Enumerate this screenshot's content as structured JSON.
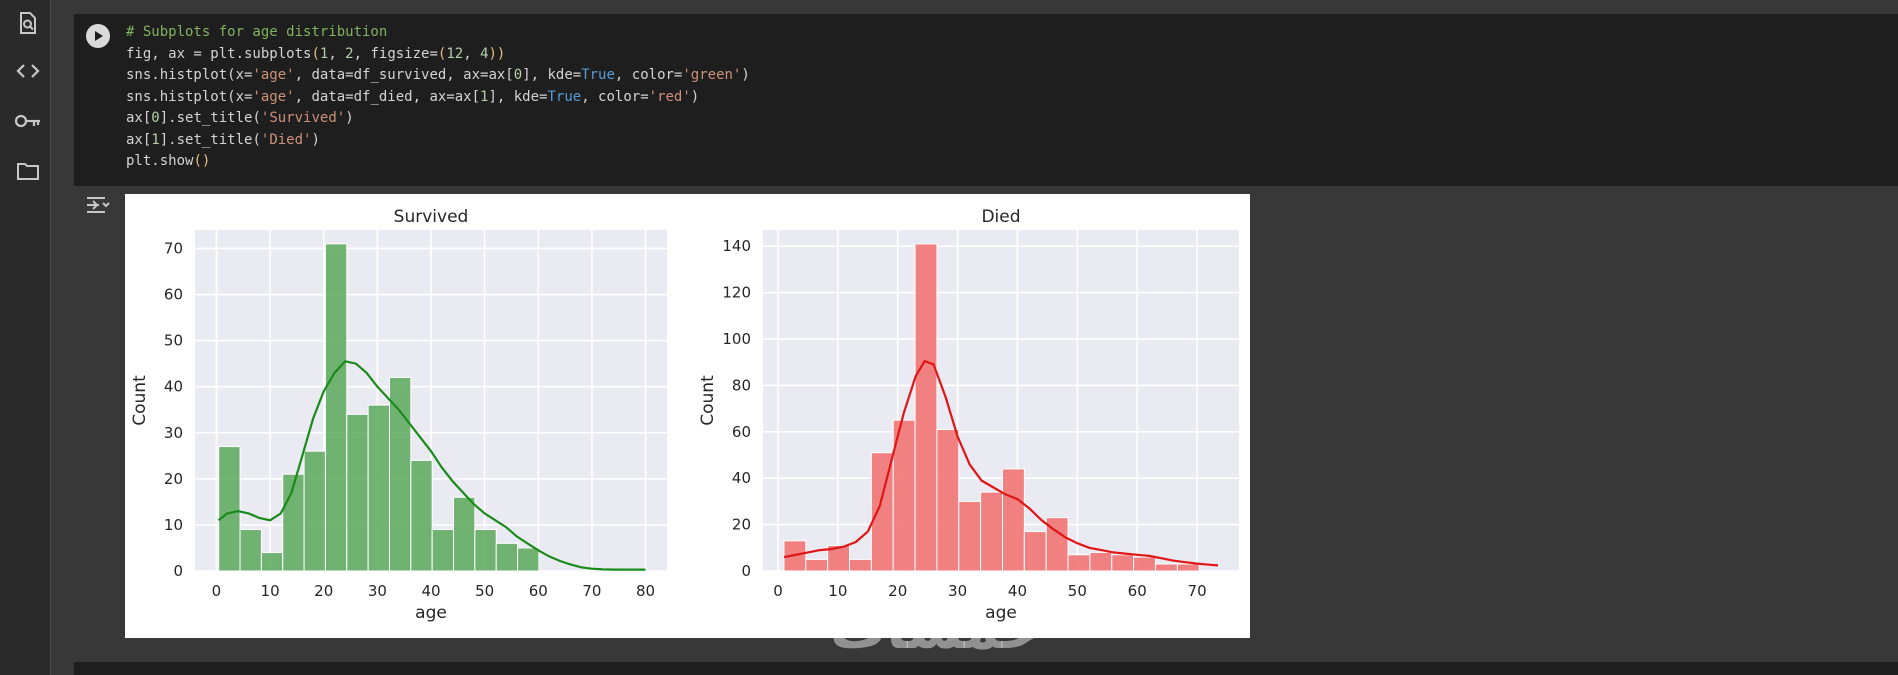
{
  "sidebar": {
    "icons": [
      "search-document-icon",
      "code-icon",
      "key-icon",
      "folder-icon"
    ]
  },
  "cell": {
    "lines": [
      [
        [
          "c-com",
          "# Subplots for age distribution"
        ]
      ],
      [
        [
          "",
          "fig, ax = plt.subplots"
        ],
        [
          "c-par",
          "("
        ],
        [
          "c-num",
          "1"
        ],
        [
          "",
          ", "
        ],
        [
          "c-num",
          "2"
        ],
        [
          "",
          ", figsize="
        ],
        [
          "c-par",
          "("
        ],
        [
          "c-num",
          "12"
        ],
        [
          "",
          ", "
        ],
        [
          "c-num",
          "4"
        ],
        [
          "c-par",
          "))"
        ]
      ],
      [
        [
          "",
          "sns.histplot(x="
        ],
        [
          "c-str",
          "'age'"
        ],
        [
          "",
          ", data=df_survived, ax=ax["
        ],
        [
          "c-num",
          "0"
        ],
        [
          "",
          "], kde="
        ],
        [
          "c-kw",
          "True"
        ],
        [
          "",
          ", color="
        ],
        [
          "c-str",
          "'green'"
        ],
        [
          "",
          ")"
        ]
      ],
      [
        [
          "",
          "sns.histplot(x="
        ],
        [
          "c-str",
          "'age'"
        ],
        [
          "",
          ", data=df_died, ax=ax["
        ],
        [
          "c-num",
          "1"
        ],
        [
          "",
          "], kde="
        ],
        [
          "c-kw",
          "True"
        ],
        [
          "",
          ", color="
        ],
        [
          "c-str",
          "'red'"
        ],
        [
          "",
          ")"
        ]
      ],
      [
        [
          "",
          "ax["
        ],
        [
          "c-num",
          "0"
        ],
        [
          "",
          "].set_title("
        ],
        [
          "c-str",
          "'Survived'"
        ],
        [
          "",
          ")"
        ]
      ],
      [
        [
          "",
          "ax["
        ],
        [
          "c-num",
          "1"
        ],
        [
          "",
          "].set_title("
        ],
        [
          "c-str",
          "'Died'"
        ],
        [
          "",
          ")"
        ]
      ],
      [
        [
          "",
          "plt.show"
        ],
        [
          "c-par",
          "()"
        ]
      ]
    ]
  },
  "watermark": "خمسات",
  "chart_data": [
    {
      "type": "bar",
      "title": "Survived",
      "xlabel": "age",
      "ylabel": "Count",
      "color": "#5aa85a",
      "edge": "#ffffff",
      "kde_color": "#1a8a1a",
      "xlim": [
        -4,
        84
      ],
      "ylim": [
        0,
        74
      ],
      "xticks": [
        0,
        10,
        20,
        30,
        40,
        50,
        60,
        70,
        80
      ],
      "yticks": [
        0,
        10,
        20,
        30,
        40,
        50,
        60,
        70
      ],
      "bin_start": 0.42,
      "bin_width": 3.98,
      "values": [
        27,
        9,
        4,
        21,
        26,
        71,
        34,
        36,
        42,
        24,
        9,
        16,
        9,
        6,
        5
      ],
      "kde": [
        [
          0.4,
          11
        ],
        [
          2,
          12.5
        ],
        [
          4,
          13
        ],
        [
          6,
          12.5
        ],
        [
          8,
          11.5
        ],
        [
          10,
          11
        ],
        [
          12,
          12.5
        ],
        [
          14,
          17
        ],
        [
          16,
          25
        ],
        [
          18,
          33
        ],
        [
          20,
          39
        ],
        [
          22,
          43
        ],
        [
          24,
          45.5
        ],
        [
          26,
          45
        ],
        [
          28,
          43
        ],
        [
          30,
          40
        ],
        [
          32,
          37.5
        ],
        [
          34,
          35
        ],
        [
          36,
          32
        ],
        [
          38,
          29
        ],
        [
          40,
          26
        ],
        [
          42,
          22.5
        ],
        [
          44,
          19.5
        ],
        [
          46,
          17
        ],
        [
          48,
          14.5
        ],
        [
          50,
          12.5
        ],
        [
          52,
          11
        ],
        [
          54,
          9.5
        ],
        [
          56,
          7.5
        ],
        [
          58,
          6
        ],
        [
          60,
          4.5
        ],
        [
          62,
          3.2
        ],
        [
          64,
          2.2
        ],
        [
          66,
          1.4
        ],
        [
          68,
          0.8
        ],
        [
          70,
          0.5
        ],
        [
          72,
          0.35
        ],
        [
          74,
          0.3
        ],
        [
          76,
          0.3
        ],
        [
          78,
          0.3
        ],
        [
          80,
          0.3
        ]
      ]
    },
    {
      "type": "bar",
      "title": "Died",
      "xlabel": "age",
      "ylabel": "Count",
      "color": "#f26d6d",
      "edge": "#ffffff",
      "kde_color": "#e01515",
      "xlim": [
        -2.5,
        77
      ],
      "ylim": [
        0,
        147
      ],
      "xticks": [
        0,
        10,
        20,
        30,
        40,
        50,
        60,
        70
      ],
      "yticks": [
        0,
        20,
        40,
        60,
        80,
        100,
        120,
        140
      ],
      "bin_start": 1,
      "bin_width": 3.65,
      "values": [
        13,
        5,
        11,
        5,
        51,
        65,
        141,
        61,
        30,
        34,
        44,
        17,
        23,
        7,
        8,
        7,
        6,
        3,
        3
      ],
      "kde": [
        [
          1,
          6
        ],
        [
          3,
          7
        ],
        [
          5,
          8
        ],
        [
          7,
          9
        ],
        [
          9,
          9.5
        ],
        [
          11,
          10.5
        ],
        [
          13,
          12.5
        ],
        [
          15,
          17
        ],
        [
          17,
          28
        ],
        [
          19,
          48
        ],
        [
          21,
          68
        ],
        [
          23,
          84
        ],
        [
          24.5,
          90.5
        ],
        [
          26,
          89
        ],
        [
          28,
          75
        ],
        [
          30,
          58
        ],
        [
          32,
          46
        ],
        [
          34,
          39
        ],
        [
          36,
          36
        ],
        [
          38,
          33
        ],
        [
          40,
          31
        ],
        [
          42,
          27
        ],
        [
          44,
          22
        ],
        [
          46,
          18
        ],
        [
          48,
          14.5
        ],
        [
          50,
          12
        ],
        [
          52,
          10
        ],
        [
          54,
          9
        ],
        [
          56,
          8
        ],
        [
          58,
          7.5
        ],
        [
          60,
          7
        ],
        [
          62,
          6.5
        ],
        [
          64,
          5.5
        ],
        [
          66,
          4.5
        ],
        [
          68,
          3.8
        ],
        [
          70,
          3.2
        ],
        [
          72,
          2.7
        ],
        [
          73.5,
          2.4
        ]
      ]
    }
  ]
}
